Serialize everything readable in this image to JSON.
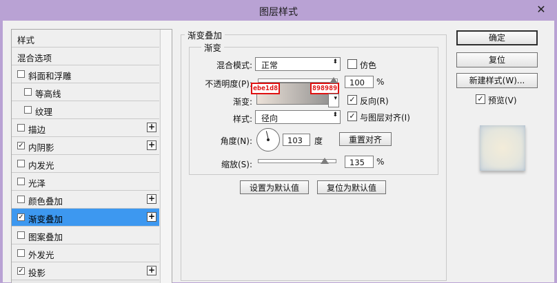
{
  "window": {
    "title": "图层样式",
    "close_glyph": "✕"
  },
  "style_list": {
    "items": [
      {
        "label": "样式",
        "checkbox": false,
        "checked": false,
        "plus": false,
        "indent": 0
      },
      {
        "label": "混合选项",
        "checkbox": false,
        "checked": false,
        "plus": false,
        "indent": 0
      },
      {
        "label": "斜面和浮雕",
        "checkbox": true,
        "checked": false,
        "plus": false,
        "indent": 0
      },
      {
        "label": "等高线",
        "checkbox": true,
        "checked": false,
        "plus": false,
        "indent": 1
      },
      {
        "label": "纹理",
        "checkbox": true,
        "checked": false,
        "plus": false,
        "indent": 1
      },
      {
        "label": "描边",
        "checkbox": true,
        "checked": false,
        "plus": true,
        "indent": 0
      },
      {
        "label": "内阴影",
        "checkbox": true,
        "checked": true,
        "plus": true,
        "indent": 0
      },
      {
        "label": "内发光",
        "checkbox": true,
        "checked": false,
        "plus": false,
        "indent": 0
      },
      {
        "label": "光泽",
        "checkbox": true,
        "checked": false,
        "plus": false,
        "indent": 0
      },
      {
        "label": "颜色叠加",
        "checkbox": true,
        "checked": false,
        "plus": true,
        "indent": 0
      },
      {
        "label": "渐变叠加",
        "checkbox": true,
        "checked": true,
        "plus": true,
        "indent": 0,
        "selected": true
      },
      {
        "label": "图案叠加",
        "checkbox": true,
        "checked": false,
        "plus": false,
        "indent": 0
      },
      {
        "label": "外发光",
        "checkbox": true,
        "checked": false,
        "plus": false,
        "indent": 0
      },
      {
        "label": "投影",
        "checkbox": true,
        "checked": true,
        "plus": true,
        "indent": 0
      }
    ]
  },
  "panel": {
    "section_title": "渐变叠加",
    "group_title": "渐变",
    "blend_mode_label": "混合模式:",
    "blend_mode_value": "正常",
    "dither_label": "仿色",
    "opacity_label": "不透明度(P):",
    "opacity_value": "100",
    "opacity_unit": "%",
    "opacity_level": 1.0,
    "gradient_label": "渐变:",
    "gradient_start_hex": "ebe1d8",
    "gradient_end_hex": "898989",
    "gradient_start_color": "#ebe1d8",
    "gradient_end_color": "#898989",
    "reverse_label": "反向(R)",
    "style_label": "样式:",
    "style_value": "径向",
    "align_label": "与图层对齐(I)",
    "angle_label": "角度(N):",
    "angle_value": "103",
    "angle_unit": "度",
    "reset_align_label": "重置对齐",
    "scale_label": "缩放(S):",
    "scale_value": "135",
    "scale_unit": "%",
    "scale_level": 0.9,
    "make_default_label": "设置为默认值",
    "reset_default_label": "复位为默认值"
  },
  "actions": {
    "ok_label": "确定",
    "reset_label": "复位",
    "new_style_label": "新建样式(W)...",
    "preview_label": "预览(V)"
  },
  "check_glyph": "✓",
  "plus_glyph": "+",
  "dropdown_glyph": "⬍",
  "gradient_dropdown_glyph": "▾"
}
